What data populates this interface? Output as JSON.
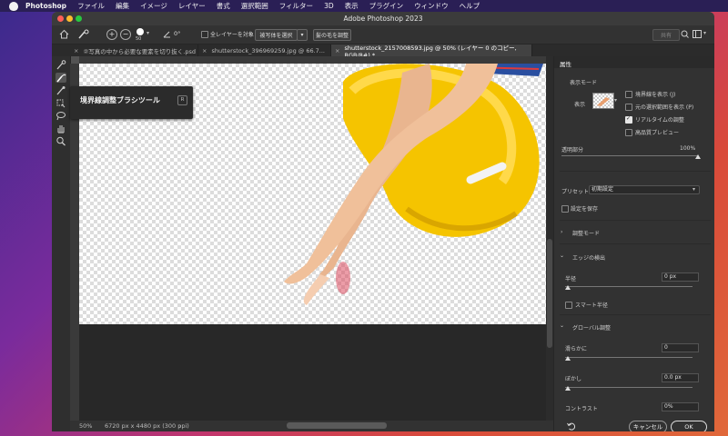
{
  "menubar": {
    "app_name": "Photoshop",
    "items": [
      "ファイル",
      "編集",
      "イメージ",
      "レイヤー",
      "書式",
      "選択範囲",
      "フィルター",
      "3D",
      "表示",
      "プラグイン",
      "ウィンドウ",
      "ヘルプ"
    ]
  },
  "window": {
    "title": "Adobe Photoshop 2023"
  },
  "options_bar": {
    "brush_size": "50",
    "angle": "0°",
    "sample_all_layers": "全レイヤーを対象",
    "select_subject": "被写体を選択",
    "refine_hair": "髪の毛を調整",
    "share_label": "共有"
  },
  "tabs": [
    {
      "label": "②写真の中から必要な要素を切り抜く.psd",
      "active": false
    },
    {
      "label": "shutterstock_396969259.jpg @ 66.7...",
      "active": false
    },
    {
      "label": "shutterstock_2157008593.jpg @ 50% (レイヤー 0 のコピー, RGB/8#) *",
      "active": true
    }
  ],
  "tooltip": {
    "title": "境界線調整ブラシツール",
    "shortcut": "R"
  },
  "status": {
    "zoom": "50%",
    "doc_info": "6720 px x 4480 px (300 ppi)"
  },
  "panel": {
    "tab_label": "属性",
    "view_mode_label": "表示モード",
    "view_label": "表示",
    "checkboxes": [
      {
        "label": "境界線を表示 (J)",
        "checked": false
      },
      {
        "label": "元の選択範囲を表示 (P)",
        "checked": false
      },
      {
        "label": "リアルタイムの調整",
        "checked": true
      },
      {
        "label": "高品質プレビュー",
        "checked": false
      }
    ],
    "opacity_label": "透明部分",
    "opacity_value": "100%",
    "opacity_level": 1.0,
    "preset_label": "プリセット",
    "preset_value": "初期設定",
    "save_settings": "設定を保存",
    "adjust_mode": "調整モード",
    "edge_detection": "エッジの検出",
    "radius_label": "半径",
    "radius_value": "0 px",
    "smart_radius": "スマート半径",
    "global_adjust": "グローバル調整",
    "smooth_label": "滑らかに",
    "smooth_value": "0",
    "feather_label": "ぼかし",
    "feather_value": "0.0 px",
    "contrast_label": "コントラスト",
    "contrast_value": "0%",
    "cancel": "キャンセル",
    "ok": "OK"
  },
  "colors": {
    "float_yellow": "#f5c400",
    "skin": "#e9b58f",
    "panel_bg": "#323232",
    "canvas_dark": "#282828"
  }
}
